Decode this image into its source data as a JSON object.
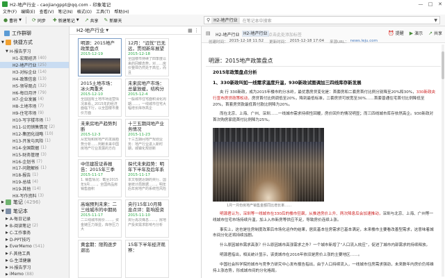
{
  "window": {
    "title": "H2-地产行业 - caojiangppt@qq.com - 印象笔记",
    "controls": [
      "—",
      "□",
      "✕"
    ]
  },
  "menu": [
    "文件(F)",
    "编辑(E)",
    "查看(V)",
    "笔记(N)",
    "格式(O)",
    "工具(T)",
    "帮助(H)"
  ],
  "toolbar": {
    "account": "曹将",
    "sync": "同步",
    "new_note": "新建笔记",
    "share": "共享",
    "new_chat": "新聊天"
  },
  "search": {
    "scope": "H2-地产行业",
    "placeholder": "在笔记本中搜索"
  },
  "sidebar": {
    "work_chat": "工作群聊",
    "shortcuts": "快捷方式",
    "h_group": "H-报告学习",
    "notebooks": [
      {
        "label": "H1-宏观经济",
        "count": "(40)"
      },
      {
        "label": "H2-地产行业",
        "count": "(25)"
      },
      {
        "label": "H3-对标企业",
        "count": "(14)"
      },
      {
        "label": "H4-政策信息",
        "count": "(13)"
      },
      {
        "label": "H5-领导观点",
        "count": "(32)"
      },
      {
        "label": "H6-每日月评",
        "count": "(79)"
      },
      {
        "label": "H7-企业发展",
        "count": "(4)"
      },
      {
        "label": "H8-土地市场",
        "count": "(7)"
      },
      {
        "label": "H9-住宅市场",
        "count": "(9)"
      },
      {
        "label": "H10-写字楼市场",
        "count": "(1)"
      },
      {
        "label": "H11-公司销售情况",
        "count": "(2)"
      },
      {
        "label": "H12-集团化战略",
        "count": "(10)"
      },
      {
        "label": "H13-开发与风险",
        "count": "(1)"
      },
      {
        "label": "H14-全国数据",
        "count": "(1)"
      },
      {
        "label": "H15-财务管理",
        "count": "(3)"
      },
      {
        "label": "H16-企划书",
        "count": "(7)"
      },
      {
        "label": "H17-问题解析",
        "count": "(1)"
      },
      {
        "label": "H18-报告",
        "count": "(1)"
      },
      {
        "label": "H19-总结",
        "count": "(4)"
      },
      {
        "label": "H19-其他",
        "count": "(14)"
      },
      {
        "label": "HX-写作资料",
        "count": "(3)"
      }
    ],
    "notes_header": "笔记",
    "notes_count": "(4296)",
    "notebooks_header": "笔记本",
    "notebooks2": [
      {
        "label": "A-每日记录",
        "count": ""
      },
      {
        "label": "B-阅读笔记",
        "count": "(2)"
      },
      {
        "label": "C-工作事务",
        "count": ""
      },
      {
        "label": "D-PPT技巧",
        "count": ""
      },
      {
        "label": "EverMemo",
        "count": "(541)"
      },
      {
        "label": "F-其他工具",
        "count": ""
      },
      {
        "label": "G-生活健康",
        "count": ""
      },
      {
        "label": "H-报告学习",
        "count": ""
      },
      {
        "label": "iMemo",
        "count": "(88)"
      }
    ]
  },
  "notelist": {
    "notebook": "H2-地产行业",
    "cards": [
      {
        "title": "明源：2015地产政策盘点",
        "date": "2015-12-19",
        "snippet": "",
        "thumb": true
      },
      {
        "title": "12月：“远忧”已无远，贯彻新年展望",
        "date": "2015-12-18",
        "snippet": "全国楼市持续了四季度以来的回暖态势，对……房价整体仍然处于高位，而且"
      },
      {
        "title": "2015土地市场：冰火两重天",
        "date": "2015-12-10",
        "snippet": "全国国有土地市场运营情况来看，2015年的经济面临下行，以全国楼市量价方面"
      },
      {
        "title": "未来房地产市场：总量放缓，结构分化",
        "date": "2015-12-4",
        "snippet": "一般城市住宅面积消化周期……，一线城市住宅大幅增长库存高企"
      },
      {
        "title": "未来房地产趋势判断",
        "date": "2015-12-3",
        "snippet": "从宏观和房地产的发展趋势分析……判断未来中国房地产行业发展的方向"
      },
      {
        "title": "十三五期间地产业务情况",
        "date": "2015-11-23",
        "snippet": "十三五期间地产规划业务：地产行业进入新时期，城镇化规划新"
      },
      {
        "title": "中信建投证券报告：2015年三季度：多",
        "date": "2015-11-17",
        "snippet": "1. 销售情况：截至2015年9月……，全国商品房销售面积"
      },
      {
        "title": "探代未来趋势：明年下半年及后年系统性",
        "date": "2015-11-17",
        "snippet": "本文根据近期的央行、国家统计局数据……，明年后年房地产的系统性风险"
      },
      {
        "title": "高端预判未来：二三线城市的中期局面",
        "date": "2015-11-17",
        "snippet": "二三线城市房价……，资金链压力渐显，库存压力大"
      },
      {
        "title": "央行15年10月降息点评：影响投资需求",
        "date": "2015-11-10",
        "snippet": "央行再次降息……，房地产投资需求影响与分析"
      },
      {
        "title": "黄金期：限购逐步退出",
        "date": "",
        "snippet": ""
      },
      {
        "title": "15年下半年经济观察：",
        "date": "",
        "snippet": ""
      }
    ]
  },
  "editor": {
    "notebook": "H2-地产行业",
    "tag": "H2-地产行业",
    "tag_placeholder": "点击此处添加标签",
    "actions": [
      "提醒",
      "演示",
      "共享"
    ],
    "meta": {
      "created_label": "创建时间：",
      "created": "2015-12-18 11:52",
      "updated_label": "更新时间：",
      "updated": "2015-12-18 17:04",
      "source_label": "来源URL：",
      "source": "news.leju.com"
    },
    "title": "明源：2015地产政策盘点",
    "body": {
      "h1": "2015年政策盘点分析",
      "h2": "1、330新政叫如一线需求温度升温，930新政试图调加三四线库存新发展",
      "p1_pre": "央 行 330新政，成为2015年楼市的分水岭，最优惠房贷变化是：首套房和二套房首付比例分别降至20%和30%，",
      "p1_red": "330新政央行宣布房贷政策松动，",
      "p1_post": "房贷首付比例调低至20%，降到最低标准，二套房贷可放宽至30%……首套普通住宅首付比例降低至20%，首套房贷款最低首付款比例降为20%。",
      "p2": "而在北京、上海、广州、深圳……一线城市需求持续性回暖，房价回升的情况明显；而三四线城市库存依然高企。930新政对首次购房家庭首付比例降为25%。",
      "caption": "1月一月份房地产销售金额同比增长率……",
      "p3_pre": "",
      "p3_red": "明源君认为，深圳等一线城市在330后的楼市狂飙，从推进房价上升、两次降息后会加速推动，",
      "p3_post": "深圳与北京、上海、广州等一线城市住宅市场持续升温，加上入市新房等供应不足，导致房价连续上涨。",
      "p4": "事实上，这也是住房制度改革后市场化运作的结果，居民基本住房需求已基本满足，未来楼市主要看改善型需求，这意味着城市间分化还将持续加剧。",
      "p5": "什么原因城市需求高涨？什么原因城市高涨需求之外？一个城市新增了“人口流入效应”，促进了城市内部需求的持续释放。",
      "p6": "明源君指出，相关统计显示，该类城市在2016年依旧是房价上涨的主要地区……。",
      "p7": "中国社会科学院的城市与竞争力研究中心发布报告指出，由于人口持续流入，一线城市住房需求强劲，未来数年内房价仍将维持上涨态势，形成城市间的分化格局。"
    }
  }
}
